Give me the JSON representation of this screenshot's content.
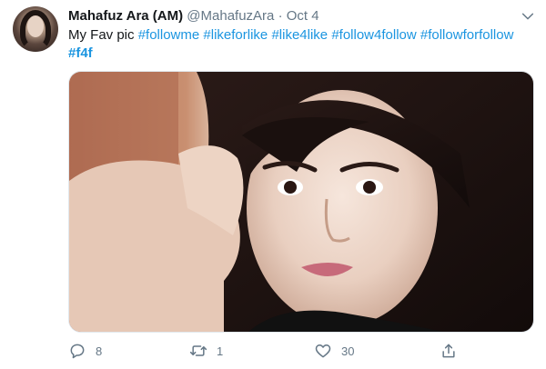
{
  "tweet": {
    "author_name": "Mahafuz Ara (AM)",
    "handle": "@MahafuzAra",
    "separator": "·",
    "date": "Oct 4",
    "text_prefix": "My Fav pic",
    "hashtags": [
      "#followme",
      "#likeforlike",
      "#like4like",
      "#follow4follow",
      "#followforfollow",
      "#f4f"
    ],
    "replies": "8",
    "retweets": "1",
    "likes": "30"
  },
  "colors": {
    "link": "#1b95e0",
    "muted": "#657786",
    "text": "#14171a"
  },
  "icons": {
    "menu": "chevron-down-icon",
    "reply": "reply-icon",
    "retweet": "retweet-icon",
    "like": "heart-icon",
    "share": "share-icon"
  }
}
